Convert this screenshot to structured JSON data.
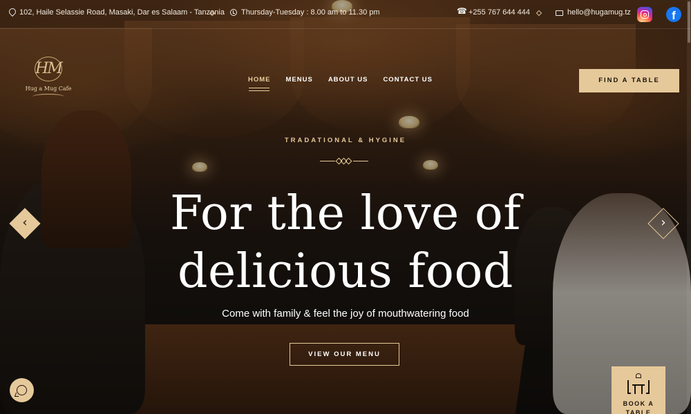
{
  "topbar": {
    "address": "102, Haile Selassie Road, Masaki, Dar es Salaam - Tanzania",
    "hours": "Thursday-Tuesday : 8.00 am to 11.30 pm",
    "phone": "+255 767 644 444",
    "email": "hello@hugamug.tz",
    "social": [
      "instagram-icon",
      "facebook-icon"
    ]
  },
  "brand": {
    "logo_monogram": "HM",
    "name": "Hug a Mug Cafe"
  },
  "nav": {
    "items": [
      "HOME",
      "MENUS",
      "ABOUT US",
      "CONTACT US"
    ],
    "active": "HOME"
  },
  "header": {
    "cta_label": "FIND A TABLE"
  },
  "hero": {
    "subtitle": "TRADATIONAL & HYGINE",
    "headline_line1": "For the love of",
    "headline_line2": "delicious food",
    "tagline": "Come with family & feel the joy of mouthwatering food",
    "button_label": "VIEW OUR MENU",
    "prev_glyph": "‹",
    "next_glyph": "›"
  },
  "widgets": {
    "whatsapp_icon": "whatsapp-icon",
    "book_label": "BOOK A TABLE"
  },
  "colors": {
    "accent": "#e6c99a",
    "dark_text": "#1b130c"
  }
}
